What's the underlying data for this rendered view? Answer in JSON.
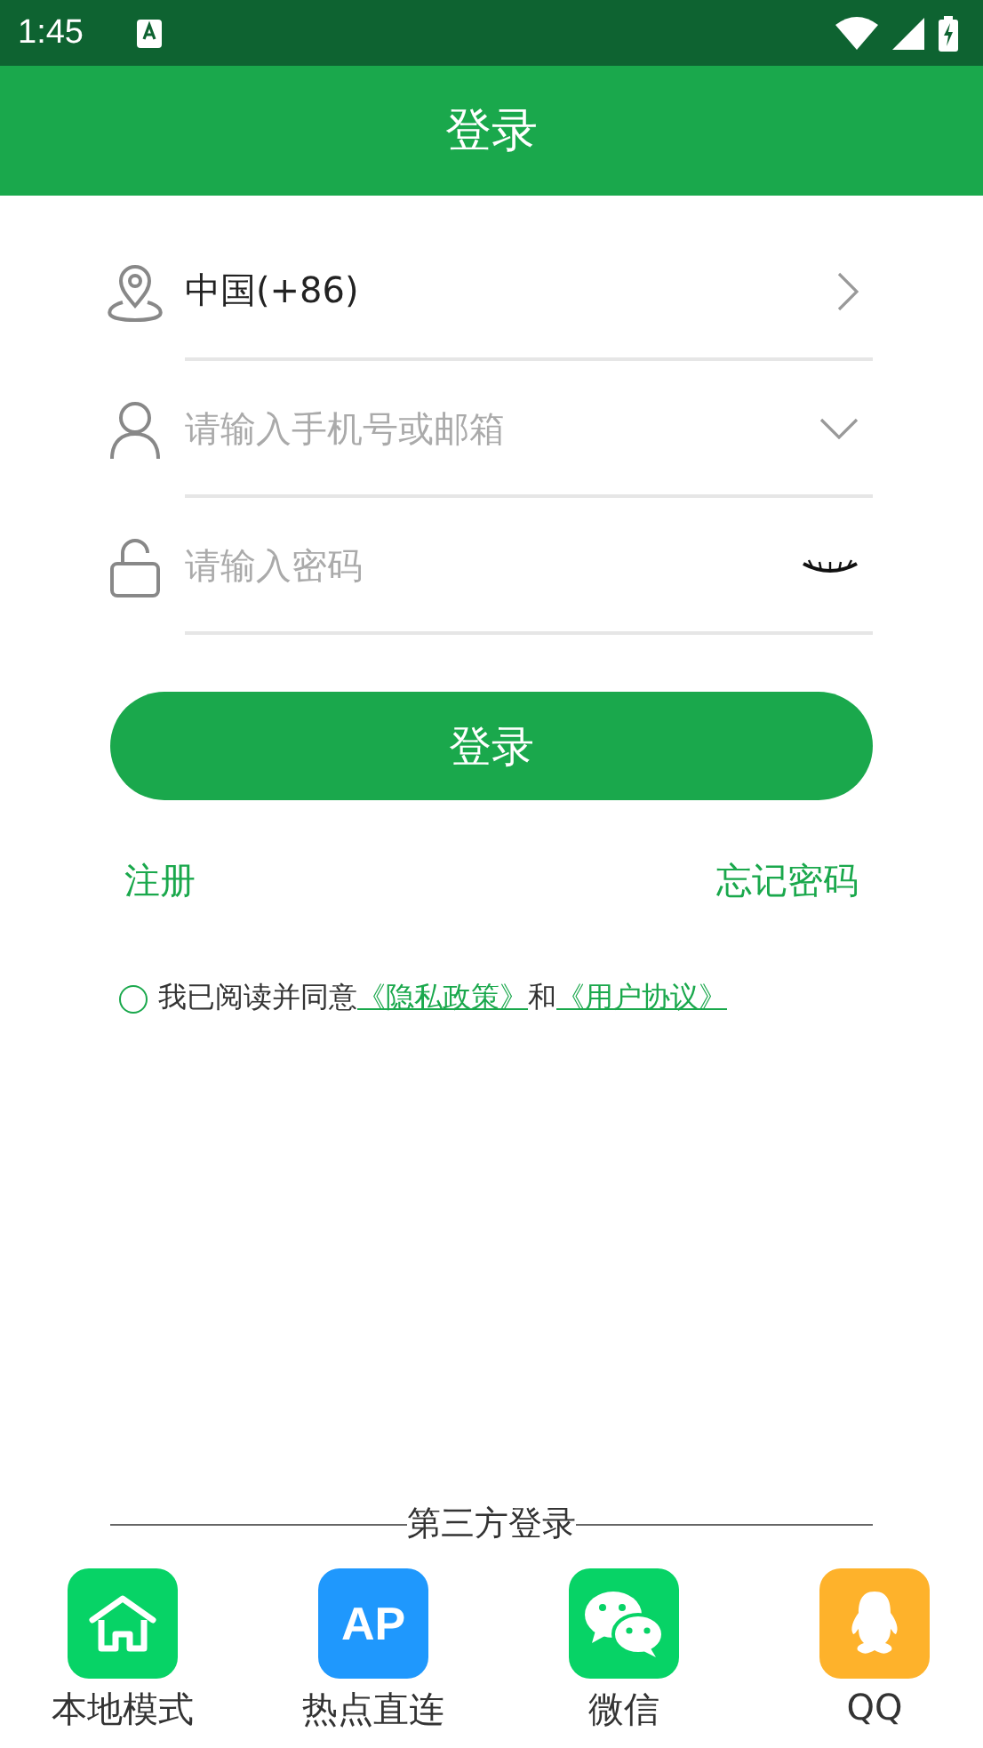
{
  "status_bar": {
    "time": "1:45"
  },
  "header": {
    "title": "登录"
  },
  "fields": [
    {
      "kind": "select",
      "value": "中国(+86)"
    },
    {
      "kind": "account",
      "placeholder": "请输入手机号或邮箱"
    },
    {
      "kind": "password",
      "placeholder": "请输入密码"
    }
  ],
  "login_button": "登录",
  "links": {
    "register": "注册",
    "forgot": "忘记密码"
  },
  "agreement": {
    "checked": false,
    "text": "我已阅读并同意",
    "privacy": "《隐私政策》",
    "and": "和",
    "terms": "《用户协议》"
  },
  "third_party": {
    "title": "第三方登录",
    "options": [
      {
        "kind": "home",
        "label": "本地模式",
        "color": "#07d366"
      },
      {
        "kind": "ap",
        "label": "热点直连",
        "badge": "AP",
        "color": "#1f98fd"
      },
      {
        "kind": "wechat",
        "label": "微信",
        "color": "#07d366"
      },
      {
        "kind": "qq",
        "label": "QQ",
        "color": "#feb22b"
      }
    ]
  }
}
